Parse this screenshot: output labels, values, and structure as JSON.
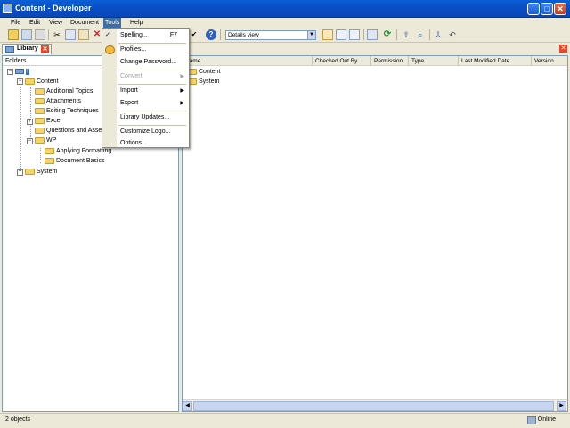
{
  "window": {
    "title": "Content - Developer"
  },
  "menubar": {
    "items": [
      "File",
      "Edit",
      "View",
      "Document",
      "Tools",
      "Help"
    ],
    "active": "Tools"
  },
  "toolbar": {
    "view_select": "Details view"
  },
  "tab": {
    "label": "Library"
  },
  "left_panel": {
    "header": "Folders",
    "tree": [
      {
        "label": "!",
        "level": 0
      },
      {
        "label": "Content",
        "level": 1
      },
      {
        "label": "Additional Topics",
        "level": 2
      },
      {
        "label": "Attachments",
        "level": 2
      },
      {
        "label": "Editing Techniques",
        "level": 2
      },
      {
        "label": "Excel",
        "level": 2
      },
      {
        "label": "Questions and Assessm",
        "level": 2
      },
      {
        "label": "WP",
        "level": 2
      },
      {
        "label": "Applying Formatting",
        "level": 3
      },
      {
        "label": "Document Basics",
        "level": 3
      },
      {
        "label": "System",
        "level": 1
      }
    ]
  },
  "right_panel": {
    "columns": [
      "Name",
      "Checked Out By",
      "Permission",
      "Type",
      "Last Modified Date",
      "Version"
    ],
    "rows": [
      {
        "name": "Content"
      },
      {
        "name": "System"
      }
    ]
  },
  "tools_menu": {
    "items": [
      {
        "label": "Spelling...",
        "shortcut": "F7"
      },
      {
        "label": "Profiles..."
      },
      {
        "label": "Change Password..."
      },
      {
        "label": "Convert",
        "disabled": true,
        "submenu": true
      },
      {
        "label": "Import",
        "submenu": true
      },
      {
        "label": "Export",
        "submenu": true
      },
      {
        "label": "Library Updates..."
      },
      {
        "label": "Customize Logo..."
      },
      {
        "label": "Options..."
      }
    ]
  },
  "statusbar": {
    "left": "2 objects",
    "right": "Online"
  }
}
